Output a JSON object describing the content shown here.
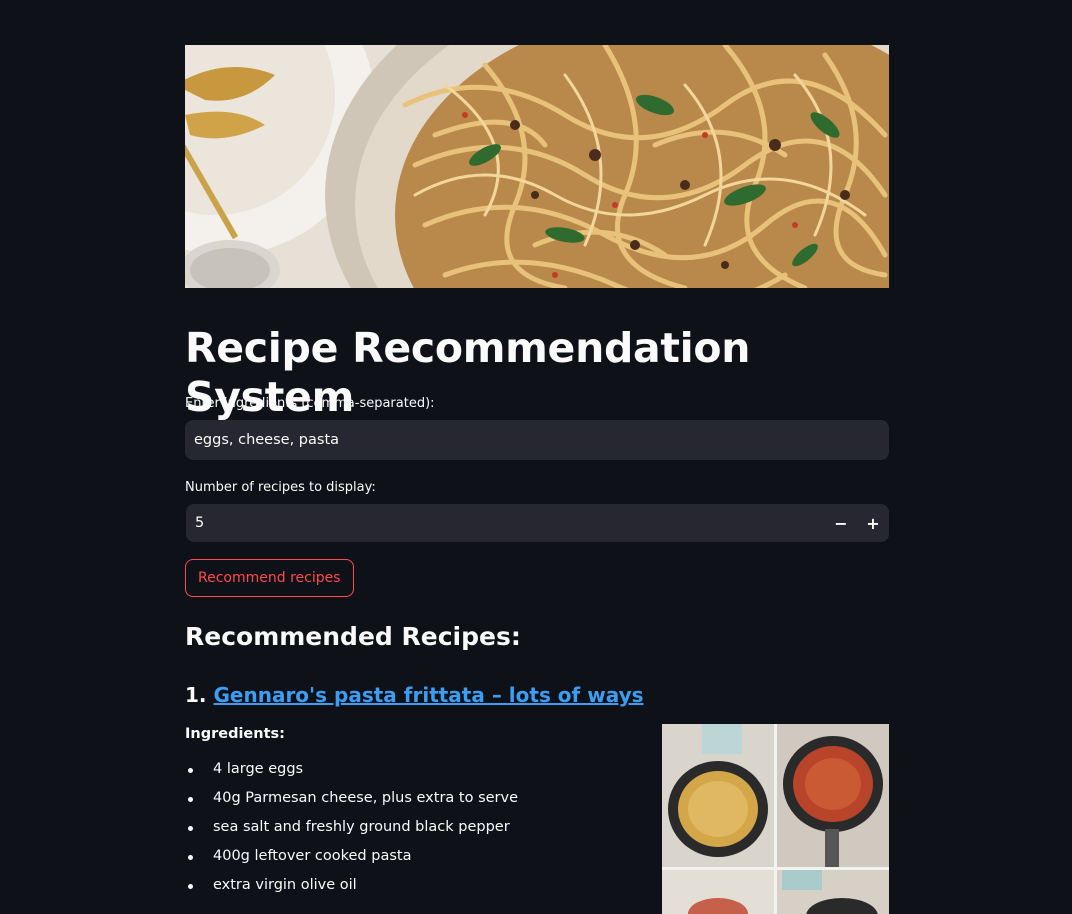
{
  "page": {
    "title": "Recipe Recommendation System"
  },
  "ingredients_input": {
    "label": "Enter ingredients (comma-separated):",
    "value": "eggs, cheese, pasta"
  },
  "recipe_count_input": {
    "label": "Number of recipes to display:",
    "value": "5",
    "decrement": "−",
    "increment": "+"
  },
  "recommend_button": {
    "label": "Recommend recipes"
  },
  "results": {
    "heading": "Recommended Recipes:",
    "recipes": [
      {
        "number": "1.",
        "name": "Gennaro's pasta frittata – lots of ways",
        "ingredients_label": "Ingredients:",
        "ingredients": [
          "4 large eggs",
          "40g Parmesan cheese, plus extra to serve",
          "sea salt and freshly ground black pepper",
          "400g leftover cooked pasta",
          "extra virgin olive oil"
        ]
      }
    ]
  },
  "colors": {
    "background": "#0e1117",
    "input_background": "#262730",
    "accent": "#ff4b4b",
    "link": "#3d9df3"
  }
}
